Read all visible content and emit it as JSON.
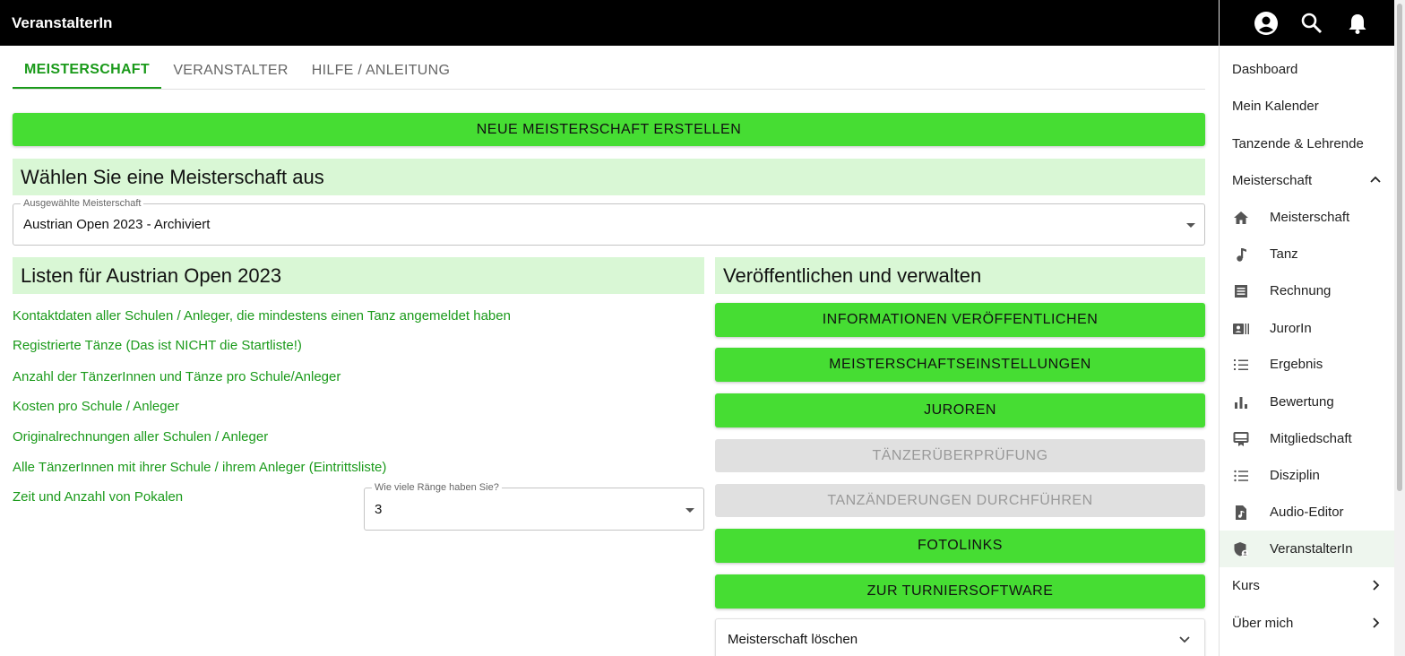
{
  "app": {
    "title": "VeranstalterIn"
  },
  "header_icons": [
    "account-circle-icon",
    "search-icon",
    "bell-icon"
  ],
  "tabs": [
    {
      "label": "MEISTERSCHAFT",
      "active": true
    },
    {
      "label": "VERANSTALTER",
      "active": false
    },
    {
      "label": "HILFE / ANLEITUNG",
      "active": false
    }
  ],
  "main": {
    "create_button": "NEUE MEISTERSCHAFT ERSTELLEN",
    "choose_heading": "Wählen Sie eine Meisterschaft aus",
    "championship_select": {
      "label": "Ausgewählte Meisterschaft",
      "value": "Austrian Open 2023 - Archiviert"
    },
    "lists_heading": "Listen für Austrian Open 2023",
    "links": [
      "Kontaktdaten aller Schulen / Anleger, die mindestens einen Tanz angemeldet haben",
      "Registrierte Tänze (Das ist NICHT die Startliste!)",
      "Anzahl der TänzerInnen und Tänze pro Schule/Anleger",
      "Kosten pro Schule / Anleger",
      "Originalrechnungen aller Schulen / Anleger",
      "Alle TänzerInnen mit ihrer Schule / ihrem Anleger (Eintrittsliste)",
      "Zeit und Anzahl von Pokalen"
    ],
    "ranks_select": {
      "label": "Wie viele Ränge haben Sie?",
      "value": "3"
    },
    "publish_heading": "Veröffentlichen und verwalten",
    "actions": [
      {
        "label": "INFORMATIONEN VERÖFFENTLICHEN",
        "disabled": false
      },
      {
        "label": "MEISTERSCHAFTSEINSTELLUNGEN",
        "disabled": false
      },
      {
        "label": "JUROREN",
        "disabled": false
      },
      {
        "label": "TÄNZERÜBERPRÜFUNG",
        "disabled": true
      },
      {
        "label": "TANZÄNDERUNGEN DURCHFÜHREN",
        "disabled": true
      },
      {
        "label": "FOTOLINKS",
        "disabled": false
      },
      {
        "label": "ZUR TURNIERSOFTWARE",
        "disabled": false
      }
    ],
    "delete_accordion": "Meisterschaft löschen"
  },
  "sidebar": {
    "items": [
      {
        "label": "Dashboard"
      },
      {
        "label": "Mein Kalender"
      },
      {
        "label": "Tanzende & Lehrende"
      },
      {
        "label": "Meisterschaft",
        "expanded": true
      },
      {
        "label": "Meisterschaft",
        "icon": "home-icon",
        "sub": true
      },
      {
        "label": "Tanz",
        "icon": "music-note-icon",
        "sub": true
      },
      {
        "label": "Rechnung",
        "icon": "receipt-icon",
        "sub": true
      },
      {
        "label": "JurorIn",
        "icon": "id-card-icon",
        "sub": true
      },
      {
        "label": "Ergebnis",
        "icon": "list-numbered-icon",
        "sub": true
      },
      {
        "label": "Bewertung",
        "icon": "bar-chart-icon",
        "sub": true
      },
      {
        "label": "Mitgliedschaft",
        "icon": "card-membership-icon",
        "sub": true
      },
      {
        "label": "Disziplin",
        "icon": "list-icon",
        "sub": true
      },
      {
        "label": "Audio-Editor",
        "icon": "audio-file-icon",
        "sub": true
      },
      {
        "label": "VeranstalterIn",
        "icon": "shield-user-icon",
        "sub": true,
        "active": true
      },
      {
        "label": "Kurs"
      },
      {
        "label": "Über mich"
      }
    ]
  },
  "colors": {
    "accent": "#46dd33",
    "accent_text": "#1a9a1a",
    "section_bg": "#d9f7d5",
    "topbar": "#000000"
  }
}
